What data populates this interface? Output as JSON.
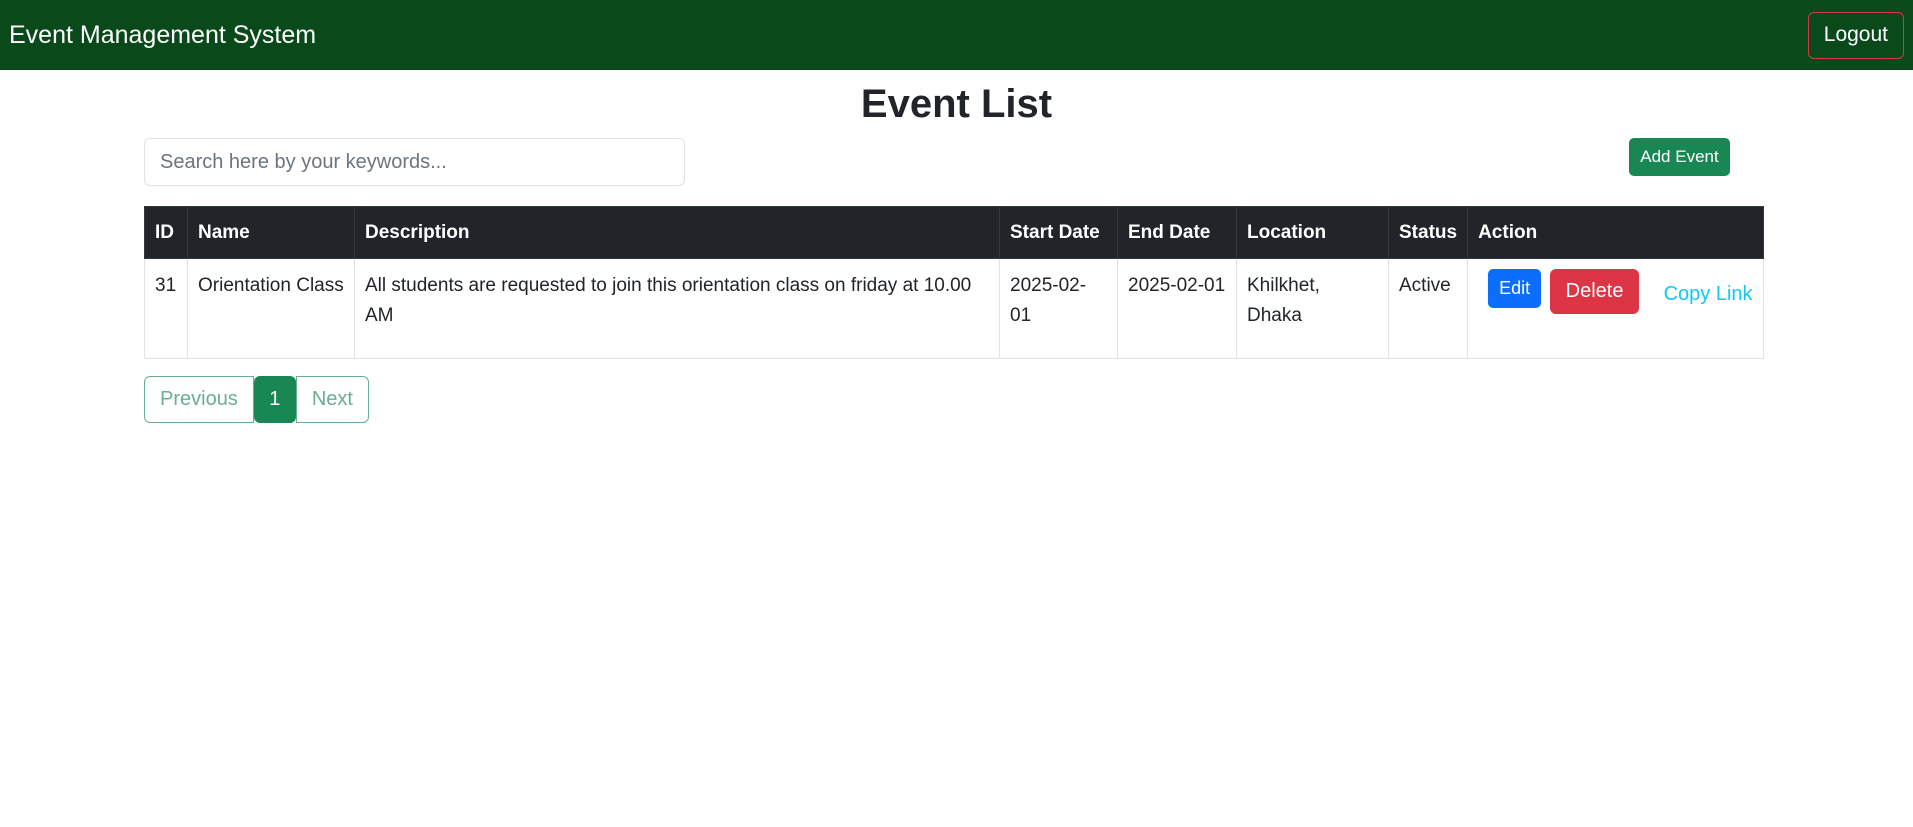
{
  "navbar": {
    "brand": "Event Management System",
    "logout_label": "Logout"
  },
  "page": {
    "title": "Event List"
  },
  "search": {
    "placeholder": "Search here by your keywords..."
  },
  "toolbar": {
    "add_label": "Add Event"
  },
  "table": {
    "headers": {
      "id": "ID",
      "name": "Name",
      "description": "Description",
      "start_date": "Start Date",
      "end_date": "End Date",
      "location": "Location",
      "status": "Status",
      "action": "Action"
    },
    "rows": [
      {
        "id": "31",
        "name": "Orientation Class",
        "description": "All students are requested to join this orientation class on friday at 10.00 AM",
        "start_date": "2025-02-01",
        "end_date": "2025-02-01",
        "location": "Khilkhet, Dhaka",
        "status": "Active",
        "actions": {
          "edit": "Edit",
          "delete": "Delete",
          "copy": "Copy Link"
        }
      }
    ]
  },
  "pagination": {
    "previous": "Previous",
    "current": "1",
    "next": "Next"
  },
  "colors": {
    "navbar": "#0a4a1a",
    "success": "#198754",
    "primary": "#0d6efd",
    "danger": "#dc3545",
    "info": "#0dcaf0",
    "table_header": "#212529"
  }
}
